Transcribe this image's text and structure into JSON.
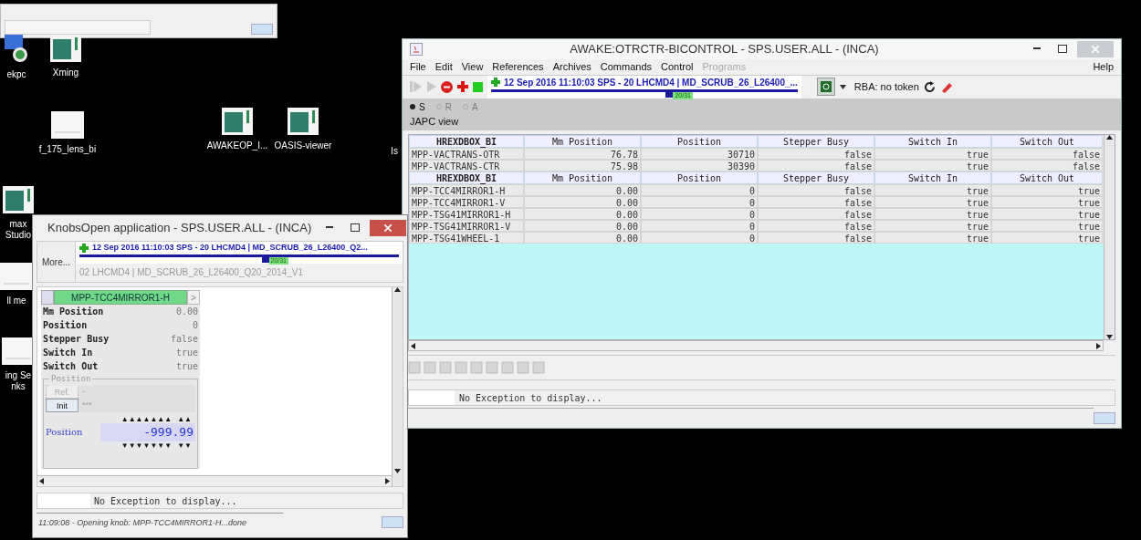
{
  "desktop_icons": [
    {
      "kind": "remote",
      "lines": [
        "ekpc"
      ]
    },
    {
      "kind": "app",
      "lines": [
        "Xming"
      ]
    },
    {
      "kind": "document",
      "lines": [
        "f_175_lens_bi"
      ]
    },
    {
      "kind": "app",
      "lines": [
        "AWAKEOP_I..."
      ]
    },
    {
      "kind": "app",
      "lines": [
        "OASIS-viewer"
      ]
    },
    {
      "kind": "none",
      "lines": [
        "Is"
      ]
    },
    {
      "kind": "app",
      "lines": [
        "max",
        "Studio"
      ]
    },
    {
      "kind": "document",
      "lines": [
        "ll me"
      ]
    },
    {
      "kind": "document",
      "lines": [
        "ing Se",
        "nks"
      ]
    }
  ],
  "main_window": {
    "title": "AWAKE:OTRCTR-BICONTROL - SPS.USER.ALL - (INCA)",
    "menu": [
      {
        "label": "File",
        "disabled": false
      },
      {
        "label": "Edit",
        "disabled": false
      },
      {
        "label": "View",
        "disabled": false
      },
      {
        "label": "References",
        "disabled": false
      },
      {
        "label": "Archives",
        "disabled": false
      },
      {
        "label": "Commands",
        "disabled": false
      },
      {
        "label": "Control",
        "disabled": false
      },
      {
        "label": "Programs",
        "disabled": true
      }
    ],
    "help": "Help",
    "timing": {
      "text": "12 Sep 2016  11:10:03  SPS - 20 LHCMD4 | MD_SCRUB_26_L26400_...",
      "cycle": "20/31",
      "level": 0.57
    },
    "rba": "RBA: no token",
    "radios": [
      {
        "label": "S",
        "selected": true,
        "disabled": false
      },
      {
        "label": "R",
        "selected": false,
        "disabled": true
      },
      {
        "label": "A",
        "selected": false,
        "disabled": true
      }
    ],
    "view_label": "JAPC view",
    "table_groups": [
      {
        "columns": [
          "HREXDBOX_BI",
          "Mm Position",
          "Position",
          "Stepper Busy",
          "Switch In",
          "Switch Out"
        ],
        "rows": [
          [
            "MPP-VACTRANS-OTR",
            "76.78",
            "30710",
            "false",
            "true",
            "false"
          ],
          [
            "MPP-VACTRANS-CTR",
            "75.98",
            "30390",
            "false",
            "true",
            "false"
          ]
        ]
      },
      {
        "columns": [
          "HREXDBOX_BI",
          "Mm Position",
          "Position",
          "Stepper Busy",
          "Switch In",
          "Switch Out"
        ],
        "rows": [
          [
            "MPP-TCC4MIRROR1-H",
            "0.00",
            "0",
            "false",
            "true",
            "true"
          ],
          [
            "MPP-TCC4MIRROR1-V",
            "0.00",
            "0",
            "false",
            "true",
            "true"
          ],
          [
            "MPP-TSG41MIRROR1-H",
            "0.00",
            "0",
            "false",
            "true",
            "true"
          ],
          [
            "MPP-TSG41MIRROR1-V",
            "0.00",
            "0",
            "false",
            "true",
            "true"
          ],
          [
            "MPP-TSG41WHEEL-1",
            "0.00",
            "0",
            "false",
            "true",
            "true"
          ]
        ]
      }
    ],
    "exception": "No Exception to display..."
  },
  "knobs_window": {
    "title": "KnobsOpen application - SPS.USER.ALL - (INCA)",
    "more_button": "More...",
    "timing": {
      "text": "12 Sep 2016  11:10:03  SPS - 20 LHCMD4 | MD_SCRUB_26_L26400_Q2...",
      "cycle": "20/31",
      "level": 0.57
    },
    "cycle_name": "02 LHCMD4 | MD_SCRUB_26_L26400_Q20_2014_V1",
    "knob": {
      "name": "MPP-TCC4MIRROR1-H",
      "next": ">",
      "rows": [
        {
          "label": "Mm Position",
          "value": "0.00"
        },
        {
          "label": "Position",
          "value": "0"
        },
        {
          "label": "Stepper Busy",
          "value": "false"
        },
        {
          "label": "Switch In",
          "value": "true"
        },
        {
          "label": "Switch Out",
          "value": "true"
        }
      ],
      "group_title": "Position",
      "ref_button": {
        "label": "Ref.",
        "disabled": true
      },
      "ref_value": "-",
      "init_button": {
        "label": "Init",
        "disabled": false
      },
      "init_value": "***",
      "up_digits": "▲▲▲▲▲▲▲",
      "up_decimals": "▲▲",
      "setting_label": "Position",
      "setting_value": "-999.99",
      "down_digits": "▼▼▼▼▼▼▼",
      "down_decimals": "▼▼"
    },
    "exception": "No Exception to display...",
    "status": "11:09:08 - Opening knob: MPP-TCC4MIRROR1-H...done"
  }
}
